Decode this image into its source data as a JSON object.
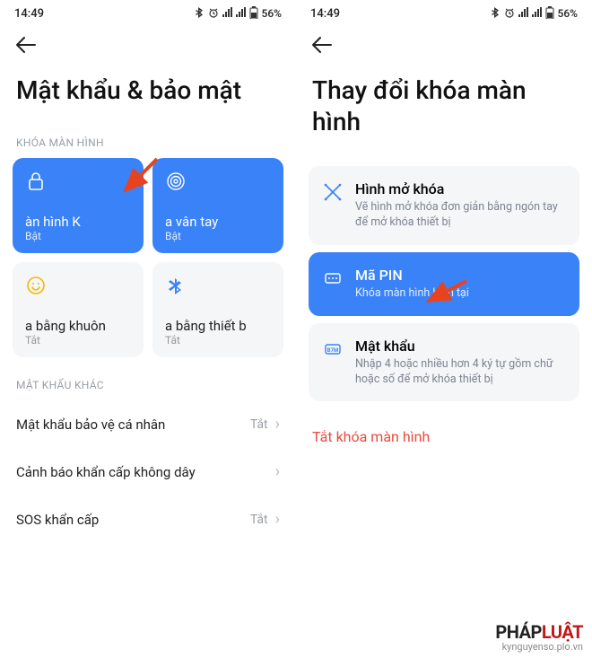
{
  "status": {
    "time": "14:49",
    "battery": "56%"
  },
  "left": {
    "title": "Mật khẩu & bảo mật",
    "section1": "KHÓA MÀN HÌNH",
    "cards": [
      {
        "title": "àn hình       K",
        "status": "Bật"
      },
      {
        "title": "a vân tay",
        "status": "Bật"
      },
      {
        "title": "a bằng khuôn",
        "status": "Tắt"
      },
      {
        "title": "a bằng thiết b",
        "status": "Tắt"
      }
    ],
    "section2": "MẬT KHẨU KHÁC",
    "items": [
      {
        "label": "Mật khẩu bảo vệ cá nhân",
        "value": "Tắt"
      },
      {
        "label": "Cảnh báo khẩn cấp không dây",
        "value": ""
      },
      {
        "label": "SOS khẩn cấp",
        "value": "Tắt"
      }
    ]
  },
  "right": {
    "title": "Thay đổi khóa màn hình",
    "options": [
      {
        "title": "Hình mở khóa",
        "desc": "Vẽ hình mở khóa đơn giản bằng ngón tay để mở khóa thiết bị"
      },
      {
        "title": "Mã PIN",
        "desc": "Khóa màn hình hiện tại"
      },
      {
        "title": "Mật khẩu",
        "desc": "Nhập 4 hoặc nhiều hơn 4 ký tự gồm chữ hoặc số để mở khóa thiết bị"
      }
    ],
    "disable": "Tắt khóa màn hình"
  },
  "watermark": {
    "brand_black": "PHÁP",
    "brand_red": "LUẬT",
    "site": "kynguyenso.plo.vn"
  }
}
